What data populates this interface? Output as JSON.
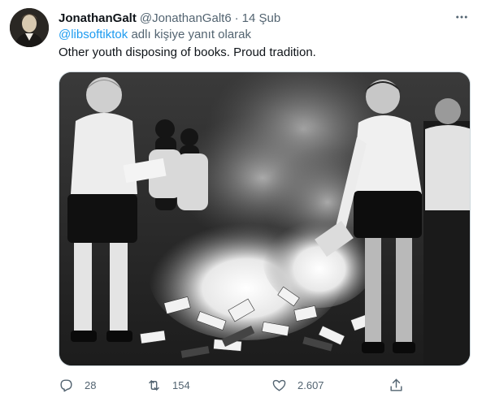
{
  "tweet": {
    "display_name": "JonathanGalt",
    "handle": "@JonathanGalt6",
    "separator": "·",
    "time": "14 Şub",
    "reply_to_mention": "@libsoftiktok",
    "reply_suffix": "adlı kişiye yanıt olarak",
    "text": "Other youth disposing of books. Proud tradition.",
    "media": {
      "alt": "Black and white photo of youths throwing books onto a large fire"
    }
  },
  "actions": {
    "replies": "28",
    "retweets": "154",
    "likes": "2.607"
  },
  "icons": {
    "more": "more-icon",
    "reply": "reply-icon",
    "retweet": "retweet-icon",
    "like": "heart-icon",
    "share": "share-icon"
  },
  "colors": {
    "accent": "#1d9bf0",
    "secondary_text": "#536471",
    "primary_text": "#0f1419"
  }
}
